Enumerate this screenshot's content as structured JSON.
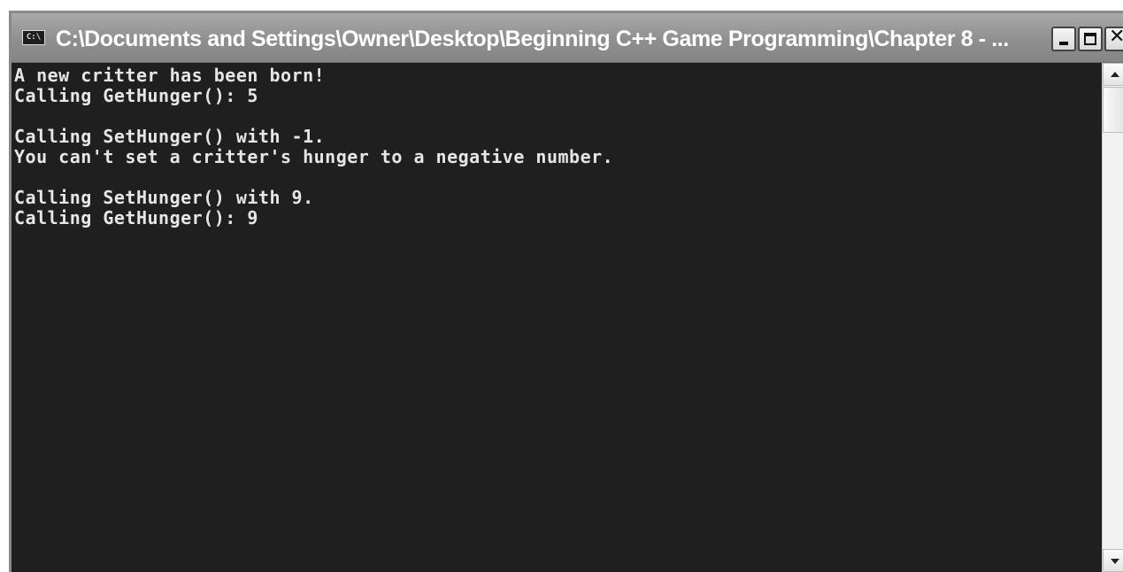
{
  "window": {
    "title": "C:\\Documents and Settings\\Owner\\Desktop\\Beginning C++ Game Programming\\Chapter 8 - ...",
    "system_icon_text": "C:\\",
    "system_icon": "console-window-icon",
    "buttons": {
      "minimize": "minimize-icon",
      "maximize": "maximize-icon",
      "close": "close-icon",
      "close_glyph": "✕"
    }
  },
  "console": {
    "lines": [
      "A new critter has been born!",
      "Calling GetHunger(): 5",
      "",
      "Calling SetHunger() with -1.",
      "You can't set a critter's hunger to a negative number.",
      "",
      "Calling SetHunger() with 9.",
      "Calling GetHunger(): 9"
    ],
    "text_color": "#e6e6e6",
    "background_color": "#1f1f1f"
  },
  "scrollbar": {
    "up_icon": "scroll-up-arrow-icon",
    "down_icon": "scroll-down-arrow-icon"
  }
}
